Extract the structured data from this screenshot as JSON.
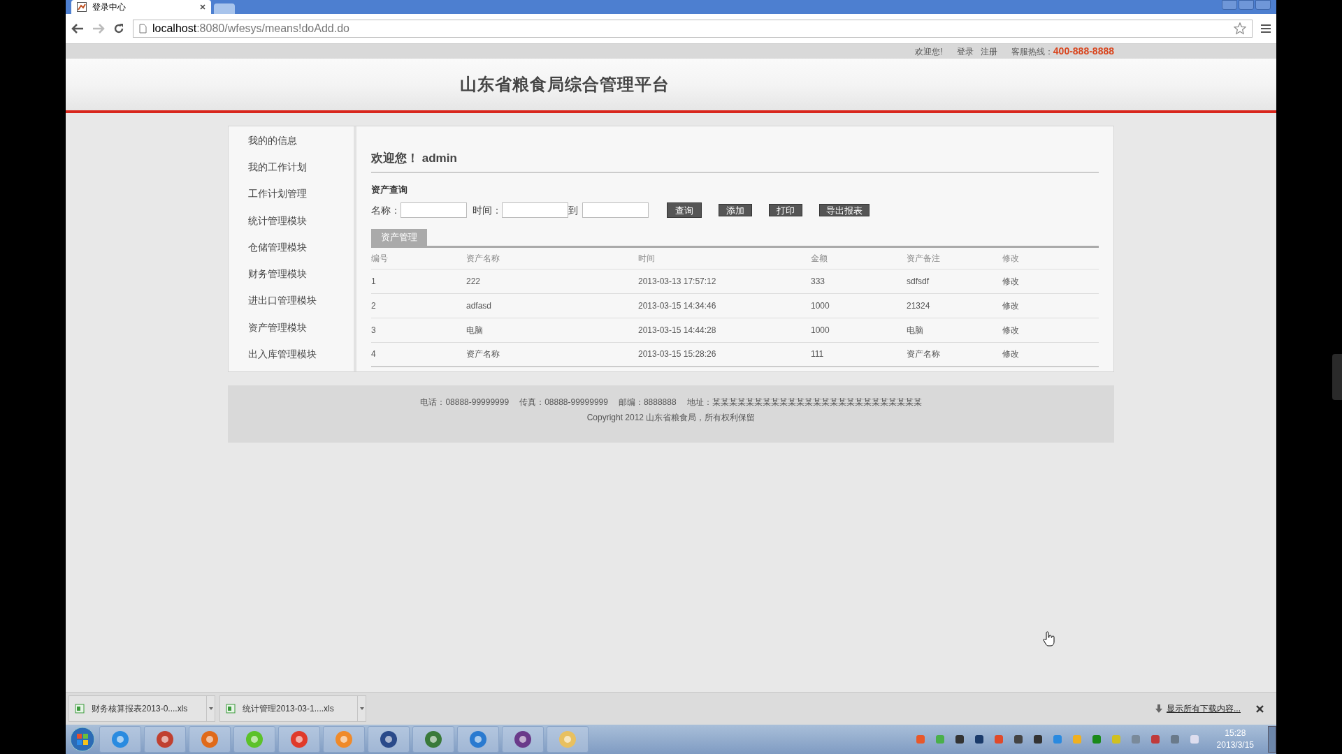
{
  "browser": {
    "tab_title": "登录中心",
    "url_host": "localhost",
    "url_path": ":8080/wfesys/means!doAdd.do"
  },
  "top_bar": {
    "welcome": "欢迎您!",
    "links": [
      "登录",
      "注册"
    ],
    "hotline_label": "客服热线：",
    "hotline": "400-888-8888"
  },
  "header": {
    "title": "山东省粮食局综合管理平台"
  },
  "sidebar": {
    "items": [
      {
        "label": "我的的信息"
      },
      {
        "label": "我的工作计划"
      },
      {
        "label": "工作计划管理"
      },
      {
        "label": "统计管理模块"
      },
      {
        "label": "仓储管理模块"
      },
      {
        "label": "财务管理模块"
      },
      {
        "label": "进出口管理模块"
      },
      {
        "label": "资产管理模块"
      },
      {
        "label": "出入库管理模块"
      }
    ]
  },
  "content": {
    "greeting": "欢迎您！",
    "user": "admin",
    "section_title": "资产查询",
    "filters": {
      "name_label": "名称：",
      "time_label": "时间：",
      "to_label": "到"
    },
    "buttons": [
      "查询",
      "添加",
      "打印",
      "导出报表"
    ],
    "tabs": [
      {
        "label": "资产管理",
        "selected": true
      }
    ],
    "table": {
      "columns": [
        "编号",
        "资产名称",
        "时间",
        "金额",
        "资产备注",
        "修改"
      ],
      "rows": [
        [
          "1",
          "222",
          "2013-03-13 17:57:12",
          "333",
          "sdfsdf",
          "修改"
        ],
        [
          "2",
          "adfasd",
          "2013-03-15 14:34:46",
          "1000",
          "21324",
          "修改"
        ],
        [
          "3",
          "电脑",
          "2013-03-15 14:44:28",
          "1000",
          "电脑",
          "修改"
        ],
        [
          "4",
          "资产名称",
          "2013-03-15 15:28:26",
          "111",
          "资产名称",
          "修改"
        ]
      ]
    }
  },
  "footer": {
    "contacts": [
      "电话：08888-99999999",
      "传真：08888-99999999",
      "邮编：8888888",
      "地址：某某某某某某某某某某某某某某某某某某某某某某某某某"
    ],
    "copyright": "Copyright 2012 山东省粮食局，所有权利保留"
  },
  "downloads": {
    "files": [
      "财务核算报表2013-0....xls",
      "统计管理2013-03-1....xls"
    ],
    "show_all": "显示所有下载内容..."
  },
  "taskbar": {
    "time": "15:28",
    "date": "2013/3/15"
  }
}
